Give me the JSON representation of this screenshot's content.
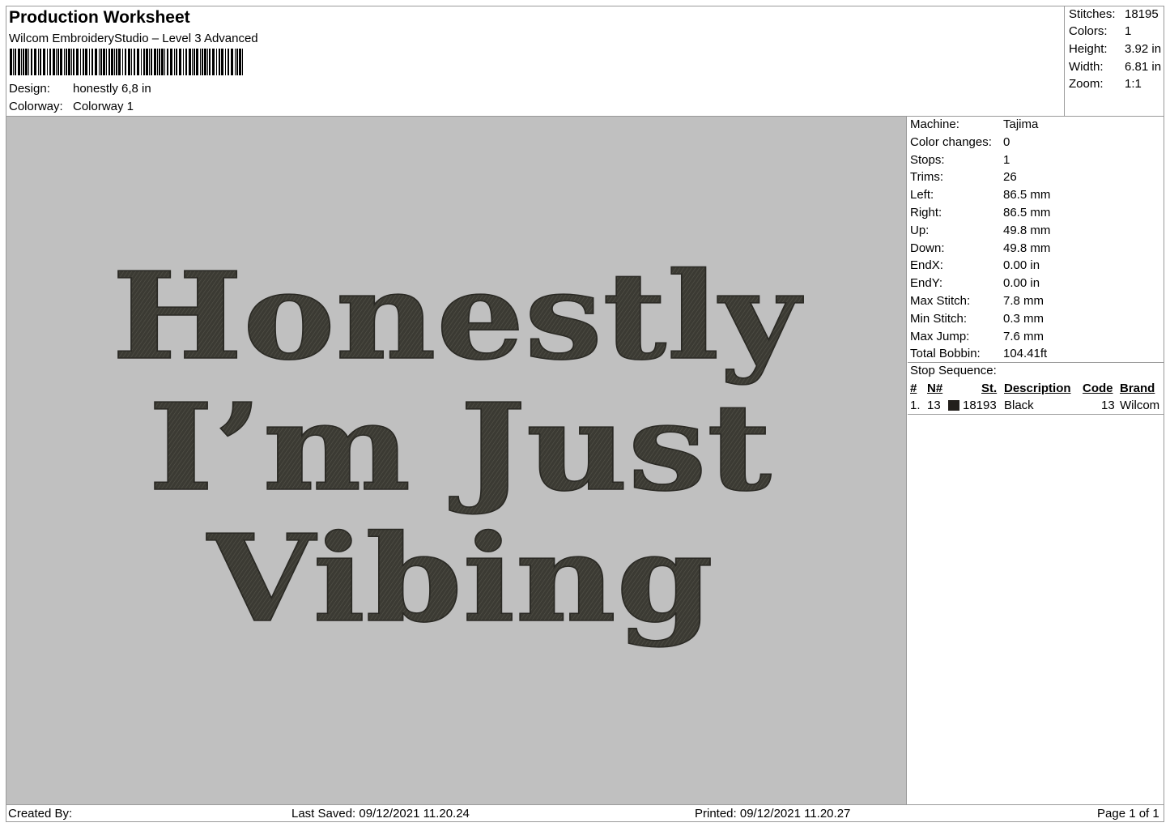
{
  "header": {
    "title": "Production Worksheet",
    "subtitle": "Wilcom EmbroideryStudio – Level 3 Advanced",
    "design_label": "Design:",
    "design_value": "honestly 6,8 in",
    "colorway_label": "Colorway:",
    "colorway_value": "Colorway 1"
  },
  "summary": [
    {
      "label": "Stitches:",
      "value": "18195"
    },
    {
      "label": "Colors:",
      "value": "1"
    },
    {
      "label": "Height:",
      "value": "3.92 in"
    },
    {
      "label": "Width:",
      "value": "6.81 in"
    },
    {
      "label": "Zoom:",
      "value": "1:1"
    }
  ],
  "preview": {
    "lines": [
      "Honestly",
      "I’m Just",
      "Vibing"
    ],
    "thread_color": "#3b3a33",
    "fabric_color": "#c0c0c0"
  },
  "details": [
    {
      "label": "Machine:",
      "value": "Tajima"
    },
    {
      "label": "Color changes:",
      "value": "0"
    },
    {
      "label": "Stops:",
      "value": "1"
    },
    {
      "label": "Trims:",
      "value": "26"
    },
    {
      "label": "Left:",
      "value": "86.5 mm"
    },
    {
      "label": "Right:",
      "value": "86.5 mm"
    },
    {
      "label": "Up:",
      "value": "49.8 mm"
    },
    {
      "label": "Down:",
      "value": "49.8 mm"
    },
    {
      "label": "EndX:",
      "value": "0.00 in"
    },
    {
      "label": "EndY:",
      "value": "0.00 in"
    },
    {
      "label": "Max Stitch:",
      "value": "7.8 mm"
    },
    {
      "label": "Min Stitch:",
      "value": "0.3 mm"
    },
    {
      "label": "Max Jump:",
      "value": "7.6 mm"
    },
    {
      "label": "Total Bobbin:",
      "value": "104.41ft"
    }
  ],
  "stop_sequence": {
    "label": "Stop Sequence:",
    "headers": {
      "num": "#",
      "n": "N#",
      "st": "St.",
      "desc": "Description",
      "code": "Code",
      "brand": "Brand"
    },
    "rows": [
      {
        "num": "1.",
        "n": "13",
        "swatch": "#231f1c",
        "st": "18193",
        "desc": "Black",
        "code": "13",
        "brand": "Wilcom"
      }
    ]
  },
  "footer": {
    "created_by": "Created By:",
    "last_saved": "Last Saved: 09/12/2021 11.20.24",
    "printed": "Printed: 09/12/2021 11.20.27",
    "page": "Page 1 of 1"
  }
}
